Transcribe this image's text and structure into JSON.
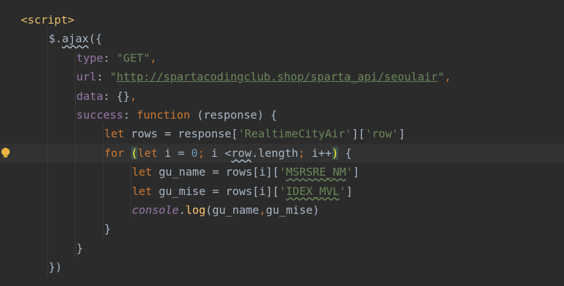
{
  "code_lines": [
    {
      "tokens": [
        {
          "t": "<script>",
          "c": "tag"
        }
      ]
    },
    {
      "tokens": [
        {
          "t": "$.",
          "c": "plain"
        },
        {
          "t": "ajax",
          "c": "plain squigw"
        },
        {
          "t": "({",
          "c": "plain"
        }
      ]
    },
    {
      "tokens": [
        {
          "t": "type",
          "c": "prop"
        },
        {
          "t": ": ",
          "c": "plain"
        },
        {
          "t": "\"GET\"",
          "c": "str"
        },
        {
          "t": ",",
          "c": "kw"
        }
      ]
    },
    {
      "tokens": [
        {
          "t": "url",
          "c": "prop"
        },
        {
          "t": ": ",
          "c": "plain"
        },
        {
          "t": "\"",
          "c": "str"
        },
        {
          "t": "http://spartacodingclub.shop/sparta_api/seoulair",
          "c": "url"
        },
        {
          "t": "\"",
          "c": "str"
        },
        {
          "t": ",",
          "c": "kw"
        }
      ]
    },
    {
      "tokens": [
        {
          "t": "data",
          "c": "prop"
        },
        {
          "t": ": {}",
          "c": "plain"
        },
        {
          "t": ",",
          "c": "kw"
        }
      ]
    },
    {
      "tokens": [
        {
          "t": "success",
          "c": "prop"
        },
        {
          "t": ": ",
          "c": "plain"
        },
        {
          "t": "function ",
          "c": "kw"
        },
        {
          "t": "(response) {",
          "c": "plain"
        }
      ]
    },
    {
      "tokens": [
        {
          "t": "let ",
          "c": "kw"
        },
        {
          "t": "rows = response[",
          "c": "plain"
        },
        {
          "t": "'RealtimeCityAir'",
          "c": "str"
        },
        {
          "t": "][",
          "c": "plain"
        },
        {
          "t": "'row'",
          "c": "str"
        },
        {
          "t": "]",
          "c": "plain"
        }
      ]
    },
    {
      "tokens": [
        {
          "t": "for ",
          "c": "kw"
        },
        {
          "t": "(",
          "c": "paren-hl"
        },
        {
          "t": "let ",
          "c": "kw"
        },
        {
          "t": "i = ",
          "c": "plain"
        },
        {
          "t": "0",
          "c": "num"
        },
        {
          "t": "; ",
          "c": "kw"
        },
        {
          "t": "i <",
          "c": "plain"
        },
        {
          "t": "row",
          "c": "plain squigw"
        },
        {
          "t": ".length",
          "c": "plain"
        },
        {
          "t": "; ",
          "c": "kw"
        },
        {
          "t": "i++",
          "c": "plain"
        },
        {
          "t": ")",
          "c": "paren-hl"
        },
        {
          "t": " {",
          "c": "plain"
        }
      ]
    },
    {
      "tokens": [
        {
          "t": "let ",
          "c": "kw"
        },
        {
          "t": "gu_name = rows[i][",
          "c": "plain"
        },
        {
          "t": "'",
          "c": "str"
        },
        {
          "t": "MSRSRE_NM",
          "c": "str squig"
        },
        {
          "t": "'",
          "c": "str"
        },
        {
          "t": "]",
          "c": "plain"
        }
      ]
    },
    {
      "tokens": [
        {
          "t": "let ",
          "c": "kw"
        },
        {
          "t": "gu_mise = rows[i][",
          "c": "plain"
        },
        {
          "t": "'",
          "c": "str"
        },
        {
          "t": "IDEX_MVL",
          "c": "str squig"
        },
        {
          "t": "'",
          "c": "str"
        },
        {
          "t": "]",
          "c": "plain"
        }
      ]
    },
    {
      "tokens": [
        {
          "t": "console",
          "c": "console"
        },
        {
          "t": ".",
          "c": "plain"
        },
        {
          "t": "log",
          "c": "fn"
        },
        {
          "t": "(gu_name",
          "c": "plain"
        },
        {
          "t": ",",
          "c": "kw"
        },
        {
          "t": "gu_mise)",
          "c": "plain"
        }
      ]
    },
    {
      "tokens": [
        {
          "t": "}",
          "c": "plain"
        }
      ]
    },
    {
      "tokens": [
        {
          "t": "}",
          "c": "plain"
        }
      ]
    },
    {
      "tokens": [
        {
          "t": "})",
          "c": "plain"
        }
      ]
    }
  ],
  "icons": {
    "intention": "lightbulb-icon"
  }
}
